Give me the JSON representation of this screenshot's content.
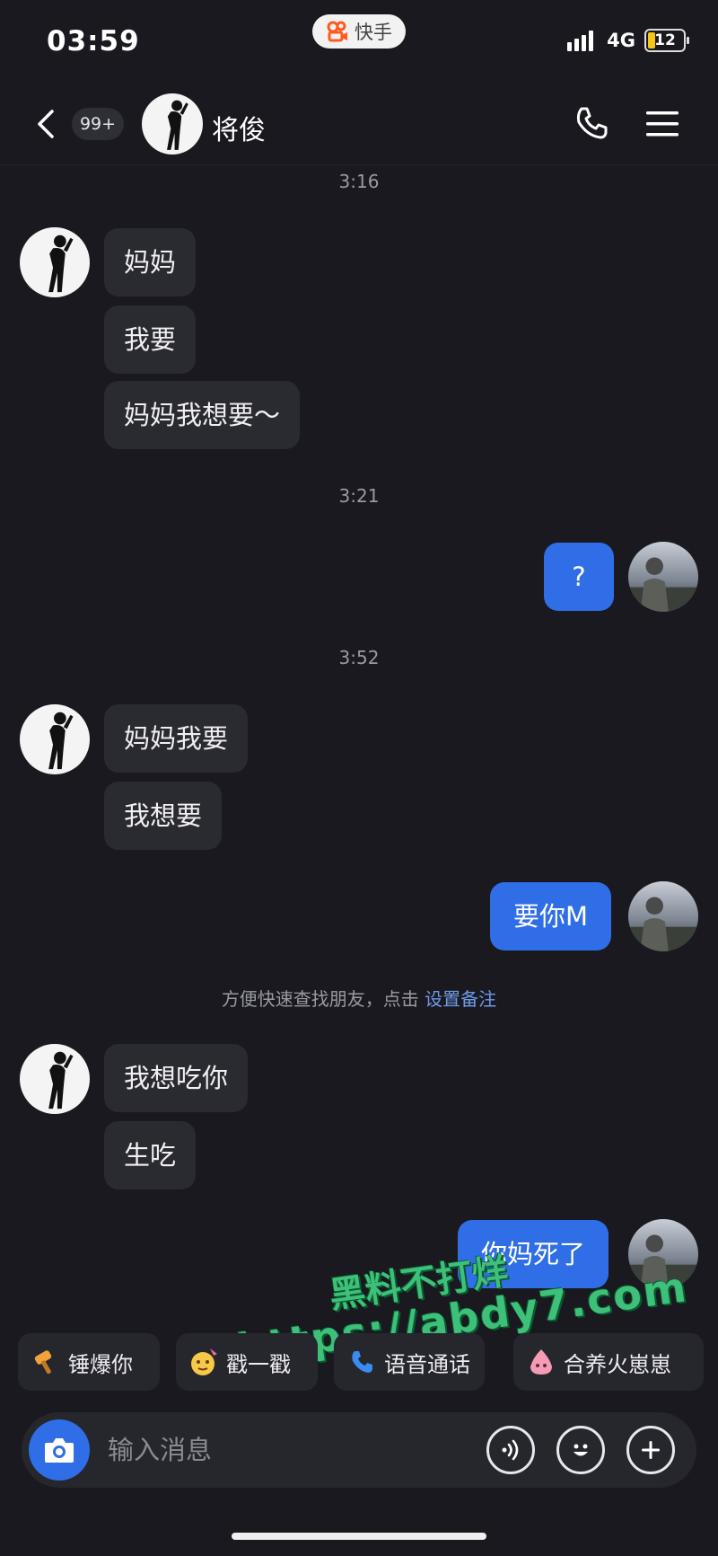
{
  "status_bar": {
    "time": "03:59",
    "app_name": "快手",
    "network": "4G",
    "battery": "12"
  },
  "header": {
    "badge": "99+",
    "contact_name": "将俊"
  },
  "messages": {
    "ts1": "3:16",
    "in1": "妈妈",
    "in2": "我要",
    "in3": "妈妈我想要～",
    "ts2": "3:21",
    "out1": "?",
    "ts3": "3:52",
    "in4": "妈妈我要",
    "in5": "我想要",
    "out2": "要你M",
    "note": "方便快速查找朋友，点击 ",
    "note_link": "设置备注",
    "in6": "我想吃你",
    "in7": "生吃",
    "out3": "你妈死了"
  },
  "watermark": {
    "line1": "黑料不打烊",
    "line2": "https://abdy7.com"
  },
  "quick_actions": [
    "锤爆你",
    "戳一戳",
    "语音通话",
    "合养火崽崽"
  ],
  "input": {
    "placeholder": "输入消息"
  },
  "colors": {
    "background": "#19191f",
    "bubble_in": "#2a2a31",
    "bubble_out": "#2f6ee6",
    "link": "#6f9ae8"
  },
  "icons": [
    "back-icon",
    "phone-icon",
    "menu-icon",
    "camera-icon",
    "voice-icon",
    "emoji-icon",
    "plus-icon"
  ]
}
